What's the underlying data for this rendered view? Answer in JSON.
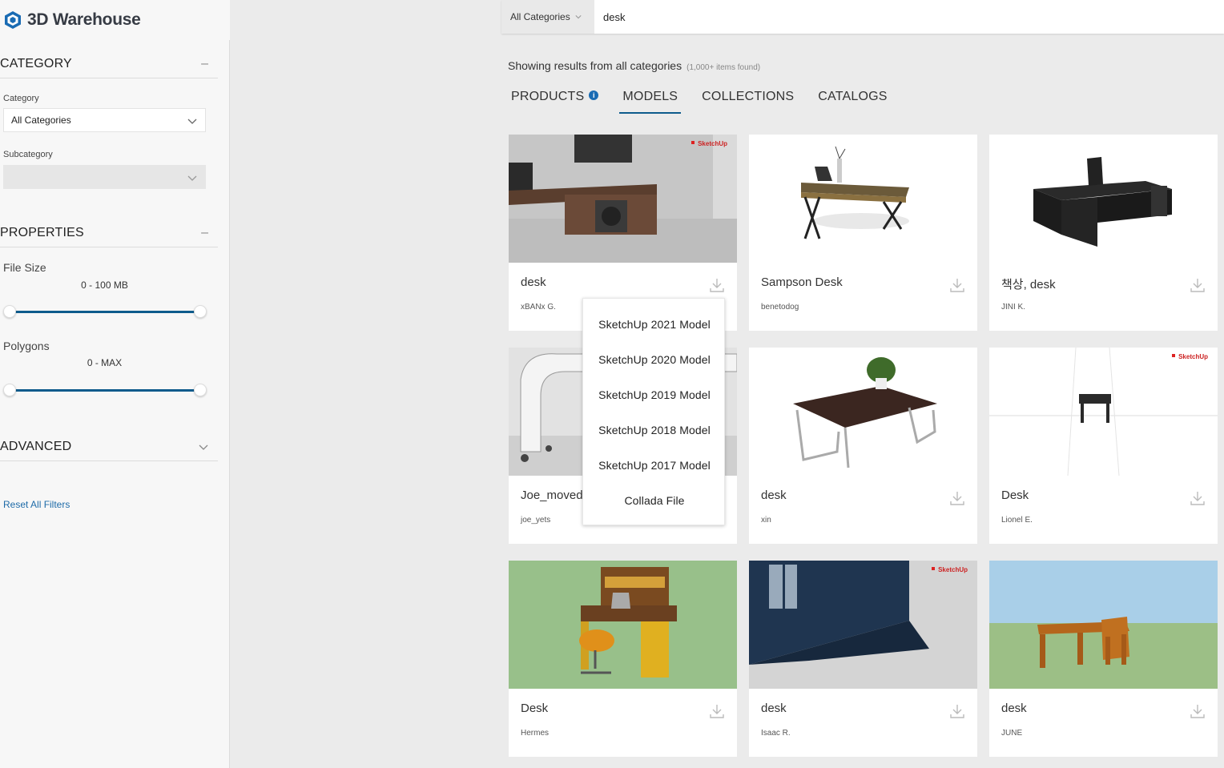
{
  "header": {
    "logo_text": "3D Warehouse",
    "search_category": "All Categories",
    "search_query": "desk"
  },
  "sidebar": {
    "category": {
      "title": "CATEGORY",
      "toggle": "–",
      "category_label": "Category",
      "category_value": "All Categories",
      "subcategory_label": "Subcategory",
      "subcategory_value": ""
    },
    "properties": {
      "title": "PROPERTIES",
      "toggle": "–",
      "file_size_label": "File Size",
      "file_size_value": "0 - 100 MB",
      "file_size_range": [
        0,
        1
      ],
      "polygons_label": "Polygons",
      "polygons_value": "0 - MAX",
      "polygons_range": [
        0,
        1
      ]
    },
    "advanced": {
      "title": "ADVANCED"
    },
    "reset_label": "Reset All Filters"
  },
  "results": {
    "showing": "Showing results from all categories",
    "count": "(1,000+ items found)"
  },
  "tabs": [
    {
      "label": "PRODUCTS",
      "active": false
    },
    {
      "label": "MODELS",
      "active": true
    },
    {
      "label": "COLLECTIONS",
      "active": false
    },
    {
      "label": "CATALOGS",
      "active": false
    }
  ],
  "cards": [
    {
      "title": "desk",
      "author": "xBANx G."
    },
    {
      "title": "Sampson Desk",
      "author": "benetodog"
    },
    {
      "title": "책상, desk",
      "author": "JINI K."
    },
    {
      "title": "Joe_moved",
      "author": "joe_yets"
    },
    {
      "title": "desk",
      "author": "xin"
    },
    {
      "title": "Desk",
      "author": "Lionel E."
    },
    {
      "title": "Desk",
      "author": "Hermes"
    },
    {
      "title": "desk",
      "author": "Isaac R."
    },
    {
      "title": "desk",
      "author": "JUNE"
    }
  ],
  "download_menu": [
    "SketchUp 2021 Model",
    "SketchUp 2020 Model",
    "SketchUp 2019 Model",
    "SketchUp 2018 Model",
    "SketchUp 2017 Model",
    "Collada File"
  ],
  "badge_text": "SketchUp",
  "colors": {
    "accent": "#0e5b8c",
    "link": "#1e6ba8",
    "info": "#1a6bb3"
  }
}
